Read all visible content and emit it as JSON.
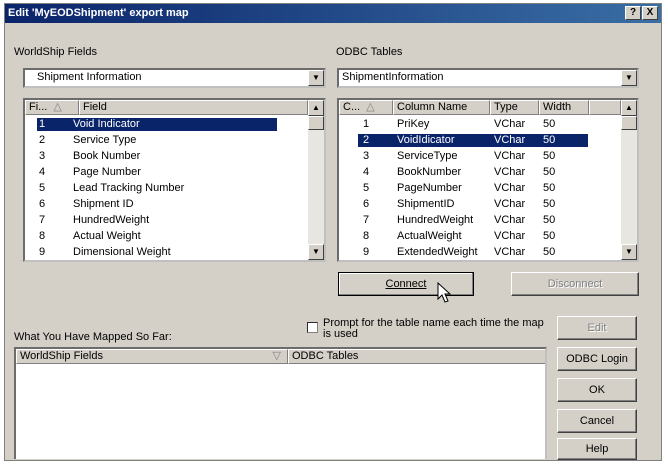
{
  "window": {
    "title": "Edit 'MyEODShipment' export map",
    "help_glyph": "?",
    "close_glyph": "X"
  },
  "left": {
    "label": "WorldShip Fields",
    "combo_value": "Shipment Information",
    "headers": [
      "Fi...",
      "Field"
    ],
    "rows": [
      {
        "num": "1",
        "name": "Void Indicator"
      },
      {
        "num": "2",
        "name": "Service Type"
      },
      {
        "num": "3",
        "name": "Book Number"
      },
      {
        "num": "4",
        "name": "Page Number"
      },
      {
        "num": "5",
        "name": "Lead Tracking Number"
      },
      {
        "num": "6",
        "name": "Shipment ID"
      },
      {
        "num": "7",
        "name": "HundredWeight"
      },
      {
        "num": "8",
        "name": "Actual Weight"
      },
      {
        "num": "9",
        "name": "Dimensional Weight"
      }
    ],
    "selected_index": 0
  },
  "right": {
    "label": "ODBC Tables",
    "combo_value": "ShipmentInformation",
    "headers": [
      "C...",
      "Column Name",
      "Type",
      "Width"
    ],
    "rows": [
      {
        "num": "1",
        "name": "PriKey",
        "type": "VChar",
        "width": "50"
      },
      {
        "num": "2",
        "name": "VoidIdicator",
        "type": "VChar",
        "width": "50"
      },
      {
        "num": "3",
        "name": "ServiceType",
        "type": "VChar",
        "width": "50"
      },
      {
        "num": "4",
        "name": "BookNumber",
        "type": "VChar",
        "width": "50"
      },
      {
        "num": "5",
        "name": "PageNumber",
        "type": "VChar",
        "width": "50"
      },
      {
        "num": "6",
        "name": "ShipmentID",
        "type": "VChar",
        "width": "50"
      },
      {
        "num": "7",
        "name": "HundredWeight",
        "type": "VChar",
        "width": "50"
      },
      {
        "num": "8",
        "name": "ActualWeight",
        "type": "VChar",
        "width": "50"
      },
      {
        "num": "9",
        "name": "ExtendedWeight",
        "type": "VChar",
        "width": "50"
      }
    ],
    "selected_index": 1
  },
  "buttons": {
    "connect": "Connect",
    "disconnect": "Disconnect",
    "edit": "Edit",
    "odbc_login": "ODBC Login",
    "ok": "OK",
    "cancel": "Cancel",
    "help": "Help"
  },
  "prompt_checkbox": {
    "label_line1": "Prompt for the table name each time the map",
    "label_line2": "is used",
    "checked": false
  },
  "mapped": {
    "label": "What You Have Mapped So Far:",
    "col_worldship": "WorldShip Fields",
    "col_odbc": "ODBC Tables"
  }
}
